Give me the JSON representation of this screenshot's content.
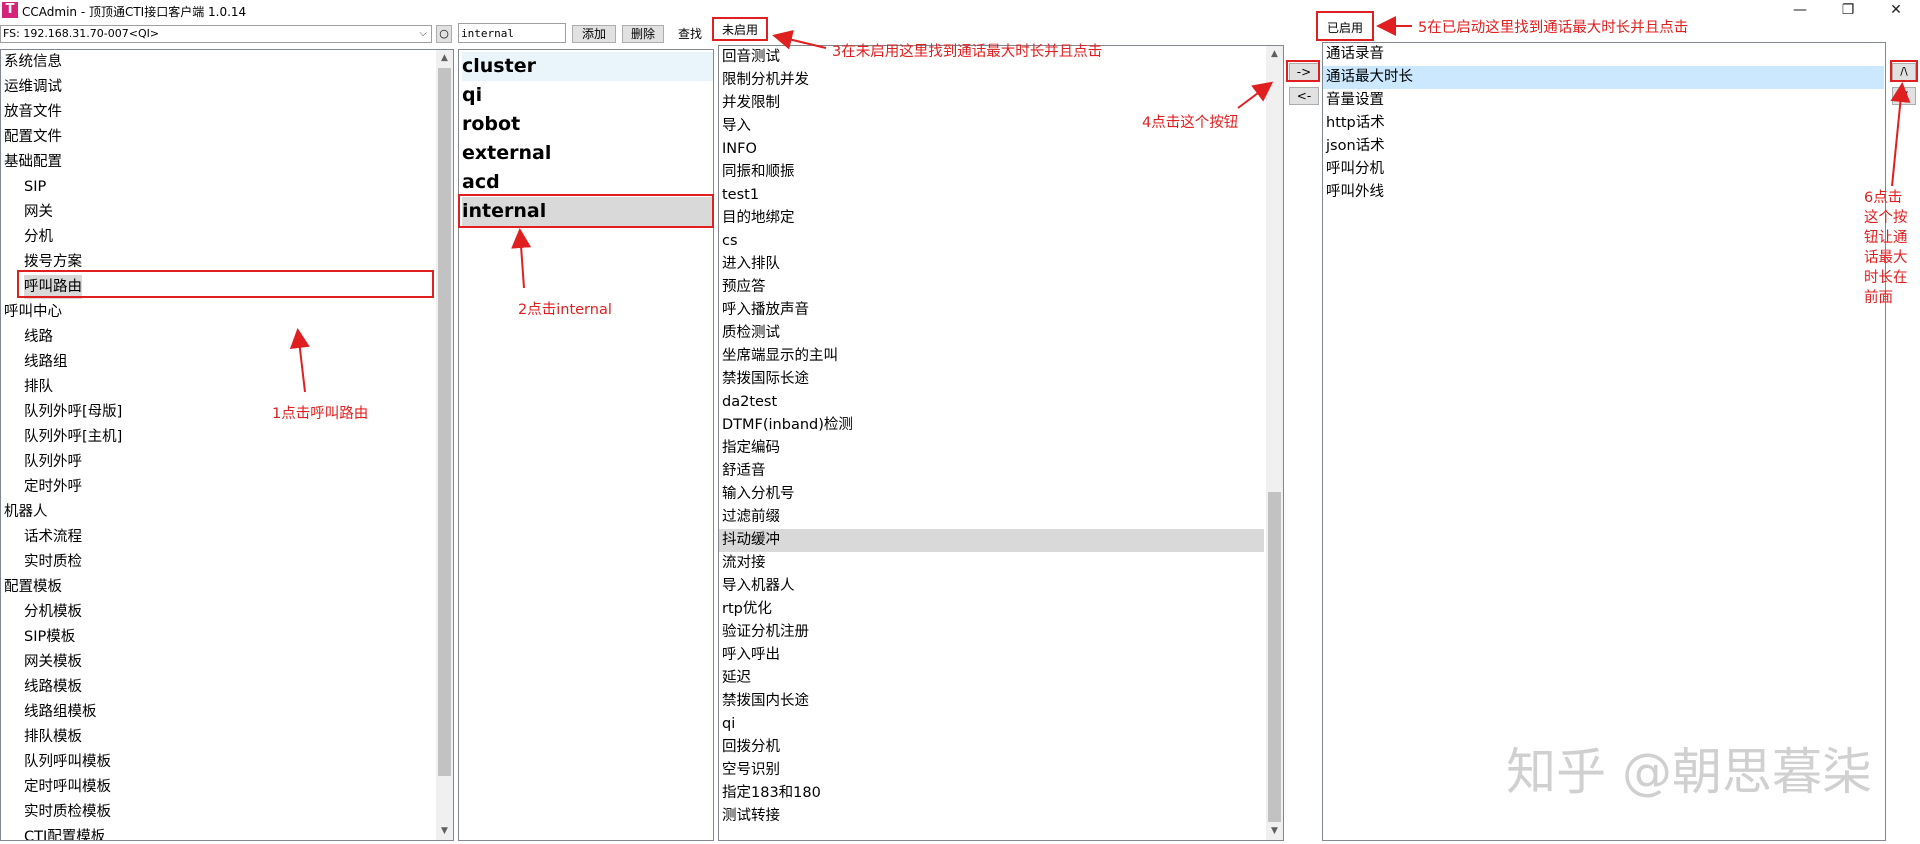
{
  "window": {
    "logo": "T",
    "title": "CCAdmin - 顶顶通CTI接口客户端 1.0.14",
    "minimize": "—",
    "restore": "❐",
    "close": "✕"
  },
  "toolbar": {
    "server": "FS: 192.168.31.70-007<QI>",
    "refresh_icon": "refresh-icon",
    "search_value": "internal",
    "add_label": "添加",
    "delete_label": "删除",
    "find_label": "查找"
  },
  "tree": {
    "items": [
      {
        "label": "系统信息",
        "level": 1
      },
      {
        "label": "运维调试",
        "level": 1
      },
      {
        "label": "放音文件",
        "level": 1
      },
      {
        "label": "配置文件",
        "level": 1
      },
      {
        "label": "基础配置",
        "level": 1
      },
      {
        "label": "SIP",
        "level": 2
      },
      {
        "label": "网关",
        "level": 2
      },
      {
        "label": "分机",
        "level": 2
      },
      {
        "label": "拨号方案",
        "level": 2
      },
      {
        "label": "呼叫路由",
        "level": 2,
        "selected": true
      },
      {
        "label": "呼叫中心",
        "level": 1
      },
      {
        "label": "线路",
        "level": 2
      },
      {
        "label": "线路组",
        "level": 2
      },
      {
        "label": "排队",
        "level": 2
      },
      {
        "label": "队列外呼[母版]",
        "level": 2
      },
      {
        "label": "队列外呼[主机]",
        "level": 2
      },
      {
        "label": "队列外呼",
        "level": 2
      },
      {
        "label": "定时外呼",
        "level": 2
      },
      {
        "label": "机器人",
        "level": 1
      },
      {
        "label": "话术流程",
        "level": 2
      },
      {
        "label": "实时质检",
        "level": 2
      },
      {
        "label": "配置模板",
        "level": 1
      },
      {
        "label": "分机模板",
        "level": 2
      },
      {
        "label": "SIP模板",
        "level": 2
      },
      {
        "label": "网关模板",
        "level": 2
      },
      {
        "label": "线路模板",
        "level": 2
      },
      {
        "label": "线路组模板",
        "level": 2
      },
      {
        "label": "排队模板",
        "level": 2
      },
      {
        "label": "队列呼叫模板",
        "level": 2
      },
      {
        "label": "定时呼叫模板",
        "level": 2
      },
      {
        "label": "实时质检模板",
        "level": 2
      },
      {
        "label": "CTI配置模板",
        "level": 2
      }
    ]
  },
  "protocols": {
    "items": [
      "cluster",
      "qi",
      "robot",
      "external",
      "acd",
      "internal"
    ],
    "selected": "internal"
  },
  "disabled": {
    "header": "未启用",
    "items": [
      "回音测试",
      "限制分机并发",
      "并发限制",
      "导入",
      "INFO",
      "同振和顺振",
      "test1",
      "目的地绑定",
      "cs",
      "进入排队",
      "预应答",
      "呼入播放声音",
      "质检测试",
      "坐席端显示的主叫",
      "禁拨国际长途",
      "da2test",
      "DTMF(inband)检测",
      "指定编码",
      "舒适音",
      "输入分机号",
      "过滤前缀",
      "抖动缓冲",
      "流对接",
      "导入机器人",
      "rtp优化",
      "验证分机注册",
      "呼入呼出",
      "延迟",
      "禁拨国内长途",
      "qi",
      "回拨分机",
      "空号识别",
      "指定183和180",
      "测试转接"
    ],
    "selected": "抖动缓冲"
  },
  "transfer": {
    "enable_label": "->",
    "disable_label": "<-"
  },
  "enabled": {
    "header": "已启用",
    "items": [
      "通话录音",
      "通话最大时长",
      "音量设置",
      "http话术",
      "json话术",
      "呼叫分机",
      "呼叫外线"
    ],
    "selected": "通话最大时长"
  },
  "order": {
    "up_label": "/\\",
    "down_label": "\\/"
  },
  "annotations": {
    "step1": "1点击呼叫路由",
    "step2": "2点击internal",
    "step3": "3在未启用这里找到通话最大时长并且点击",
    "step4": "4点击这个按钮",
    "step5": "5在已启动这里找到通话最大时长并且点击",
    "step6": [
      "6点击",
      "这个按",
      "钮让通",
      "话最大",
      "时长在",
      "前面"
    ]
  },
  "watermark": "知乎 @朝思暮柒",
  "colors": {
    "annotation": "#e02020",
    "selection": "#d9d9d9",
    "enabled_selection": "#cce8ff",
    "logo": "#d4237a"
  }
}
